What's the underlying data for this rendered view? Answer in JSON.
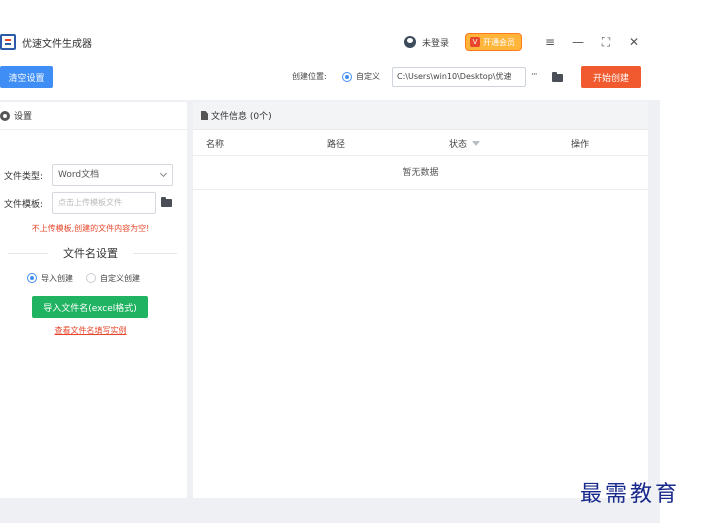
{
  "app": {
    "title": "优速文件生成器",
    "login_text": "未登录",
    "vip_label": "开通会员",
    "vip_icon_glyph": "V",
    "window_buttons": {
      "menu": "≡",
      "minimize": "—",
      "maximize": "⛶",
      "close": "✕"
    }
  },
  "toolbar": {
    "clear_label": "清空设置",
    "location_label": "创建位置:",
    "custom_label": "自定义",
    "path_value": "C:\\Users\\win10\\Desktop\\优速",
    "more_label": "···",
    "start_label": "开始创建"
  },
  "settings": {
    "title": "设置",
    "file_type_label": "文件类型:",
    "file_type_value": "Word文档",
    "template_label": "文件模板:",
    "template_placeholder": "点击上传模板文件",
    "warning": "不上传模板,创建的文件内容为空!",
    "filename_section_title": "文件名设置",
    "option_import": "导入创建",
    "option_custom": "自定义创建",
    "import_button": "导入文件名(excel格式)",
    "example_link": "查看文件名填写实例"
  },
  "file_panel": {
    "title": "文件信息 (0个)",
    "columns": [
      "名称",
      "路径",
      "状态",
      "操作"
    ],
    "empty_text": "暂无数据"
  },
  "watermark": "最需教育",
  "colors": {
    "primary_blue": "#3f8ef5",
    "start_orange": "#f05a2e",
    "import_green": "#1fb362",
    "warning_red": "#e8472b",
    "vip_orange": "#ffb43a"
  }
}
